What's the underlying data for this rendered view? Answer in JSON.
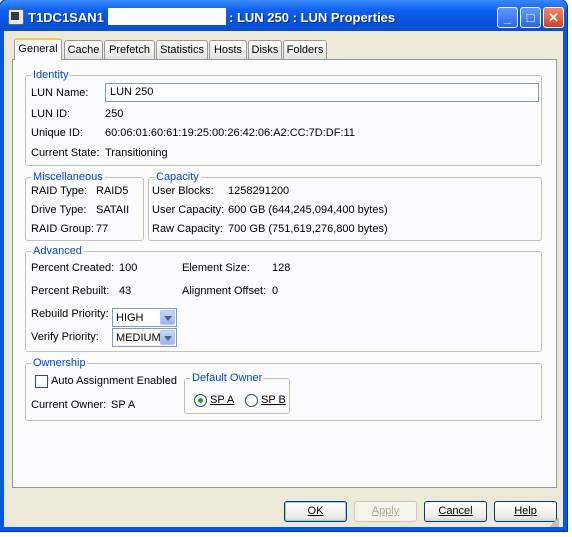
{
  "window": {
    "title_prefix": "T1DC1SAN1",
    "title_suffix": ": LUN 250 : LUN Properties",
    "minimize": "_",
    "maximize": "□",
    "close": "✕"
  },
  "tabs": [
    "General",
    "Cache",
    "Prefetch",
    "Statistics",
    "Hosts",
    "Disks",
    "Folders"
  ],
  "identity": {
    "title": "Identity",
    "lun_name_label": "LUN Name:",
    "lun_name_value": "LUN 250",
    "lun_id_label": "LUN ID:",
    "lun_id_value": "250",
    "unique_id_label": "Unique ID:",
    "unique_id_value": "60:06:01:60:61:19:25:00:26:42:06:A2:CC:7D:DF:11",
    "state_label": "Current State:",
    "state_value": "Transitioning"
  },
  "misc": {
    "title": "Miscellaneous",
    "raid_type_label": "RAID Type:",
    "raid_type_value": "RAID5",
    "drive_type_label": "Drive Type:",
    "drive_type_value": "SATAII",
    "raid_group_label": "RAID Group:",
    "raid_group_value": "77"
  },
  "capacity": {
    "title": "Capacity",
    "user_blocks_label": "User Blocks:",
    "user_blocks_value": "1258291200",
    "user_capacity_label": "User Capacity:",
    "user_capacity_value": "600 GB (644,245,094,400 bytes)",
    "raw_capacity_label": "Raw Capacity:",
    "raw_capacity_value": "700 GB (751,619,276,800 bytes)"
  },
  "advanced": {
    "title": "Advanced",
    "percent_created_label": "Percent Created:",
    "percent_created_value": "100",
    "element_size_label": "Element Size:",
    "element_size_value": "128",
    "percent_rebuilt_label": "Percent Rebuilt:",
    "percent_rebuilt_value": "43",
    "alignment_offset_label": "Alignment Offset:",
    "alignment_offset_value": "0",
    "rebuild_priority_label": "Rebuild Priority:",
    "rebuild_priority_value": "HIGH",
    "verify_priority_label": "Verify Priority:",
    "verify_priority_value": "MEDIUM"
  },
  "ownership": {
    "title": "Ownership",
    "auto_assign_label": "Auto Assignment Enabled",
    "auto_assign_checked": false,
    "current_owner_label": "Current Owner:",
    "current_owner_value": "SP A",
    "default_owner_title": "Default Owner",
    "sp_a_label": "SP A",
    "sp_b_label": "SP B",
    "default_owner_selected": "SP A"
  },
  "buttons": {
    "ok": "OK",
    "apply": "Apply",
    "cancel": "Cancel",
    "help": "Help"
  }
}
